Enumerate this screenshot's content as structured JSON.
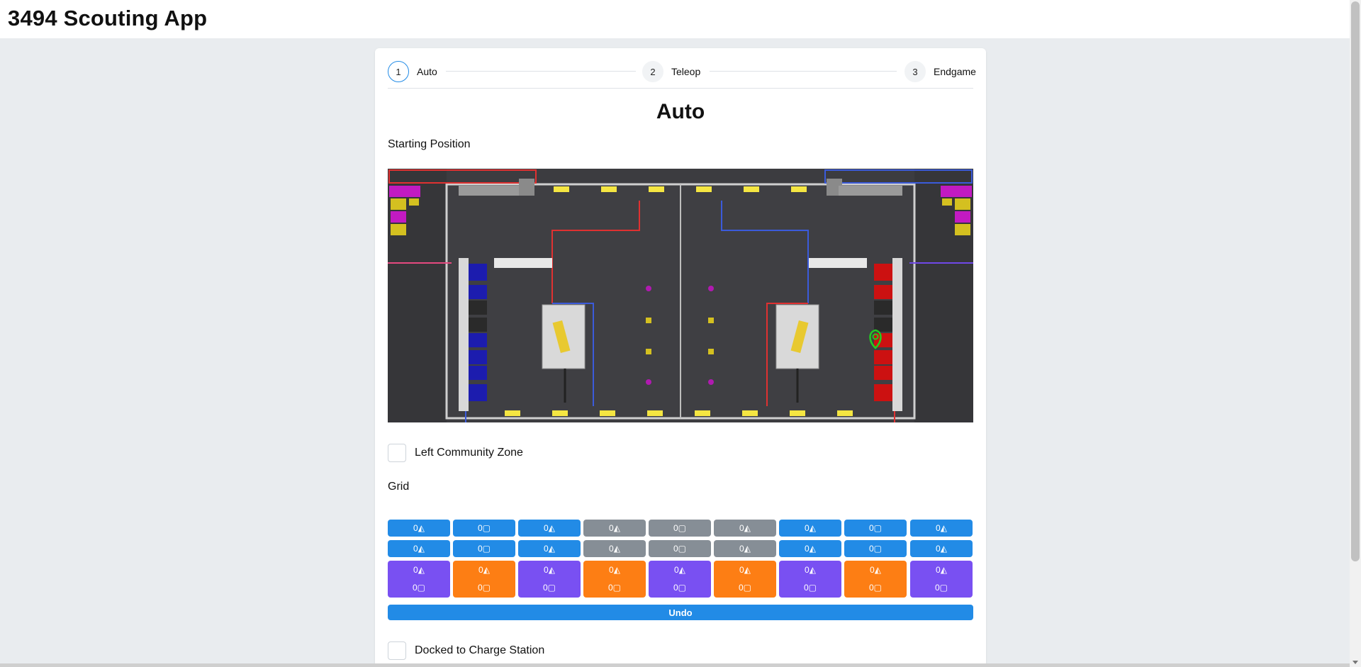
{
  "app": {
    "title": "3494 Scouting App"
  },
  "stepper": {
    "steps": [
      {
        "number": "1",
        "label": "Auto",
        "active": true
      },
      {
        "number": "2",
        "label": "Teleop",
        "active": false
      },
      {
        "number": "3",
        "label": "Endgame",
        "active": false
      }
    ]
  },
  "section": {
    "title": "Auto"
  },
  "starting_position": {
    "label": "Starting Position"
  },
  "left_community": {
    "label": "Left Community Zone",
    "checked": false
  },
  "grid": {
    "label": "Grid",
    "cone_icon": "cone-icon",
    "cube_icon": "cube-icon",
    "rows": [
      {
        "type": "high",
        "cells": [
          {
            "color": "blue",
            "text": "0◭"
          },
          {
            "color": "blue",
            "text": "0▢"
          },
          {
            "color": "blue",
            "text": "0◭"
          },
          {
            "color": "gray",
            "text": "0◭"
          },
          {
            "color": "gray",
            "text": "0▢"
          },
          {
            "color": "gray",
            "text": "0◭"
          },
          {
            "color": "blue",
            "text": "0◭"
          },
          {
            "color": "blue",
            "text": "0▢"
          },
          {
            "color": "blue",
            "text": "0◭"
          }
        ]
      },
      {
        "type": "mid",
        "cells": [
          {
            "color": "blue",
            "text": "0◭"
          },
          {
            "color": "blue",
            "text": "0▢"
          },
          {
            "color": "blue",
            "text": "0◭"
          },
          {
            "color": "gray",
            "text": "0◭"
          },
          {
            "color": "gray",
            "text": "0▢"
          },
          {
            "color": "gray",
            "text": "0◭"
          },
          {
            "color": "blue",
            "text": "0◭"
          },
          {
            "color": "blue",
            "text": "0▢"
          },
          {
            "color": "blue",
            "text": "0◭"
          }
        ]
      },
      {
        "type": "hybrid",
        "cells": [
          {
            "color": "purple",
            "cone": "0◭",
            "cube": "0▢"
          },
          {
            "color": "orange",
            "cone": "0◭",
            "cube": "0▢"
          },
          {
            "color": "purple",
            "cone": "0◭",
            "cube": "0▢"
          },
          {
            "color": "orange",
            "cone": "0◭",
            "cube": "0▢"
          },
          {
            "color": "purple",
            "cone": "0◭",
            "cube": "0▢"
          },
          {
            "color": "orange",
            "cone": "0◭",
            "cube": "0▢"
          },
          {
            "color": "purple",
            "cone": "0◭",
            "cube": "0▢"
          },
          {
            "color": "orange",
            "cone": "0◭",
            "cube": "0▢"
          },
          {
            "color": "purple",
            "cone": "0◭",
            "cube": "0▢"
          }
        ]
      }
    ]
  },
  "undo": {
    "label": "Undo"
  },
  "docked": {
    "label": "Docked to Charge Station",
    "checked": false
  },
  "colors": {
    "blue": "#228be6",
    "gray": "#868e96",
    "purple": "#7950f2",
    "orange": "#fd7e14",
    "page_bg": "#e9ecef",
    "marker": "#22cc22"
  }
}
